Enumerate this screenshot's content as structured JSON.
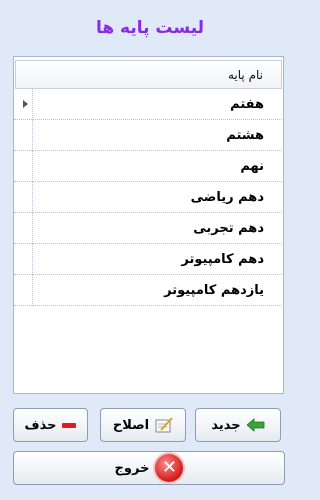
{
  "title": "لیست پایه ها",
  "grid": {
    "column_header": "نام پایه",
    "rows": [
      "هفتم",
      "هشتم",
      "نهم",
      "دهم ریاضی",
      "دهم تجربی",
      "دهم کامپیوتر",
      "یازدهم کامپیوتر"
    ]
  },
  "buttons": {
    "delete": "حذف",
    "edit": "اصلاح",
    "new": "جدید",
    "exit": "خروج"
  },
  "icons": {
    "delete": "minus-icon",
    "edit": "edit-note-icon",
    "new": "green-arrow-icon",
    "exit": "close-circle-icon"
  }
}
